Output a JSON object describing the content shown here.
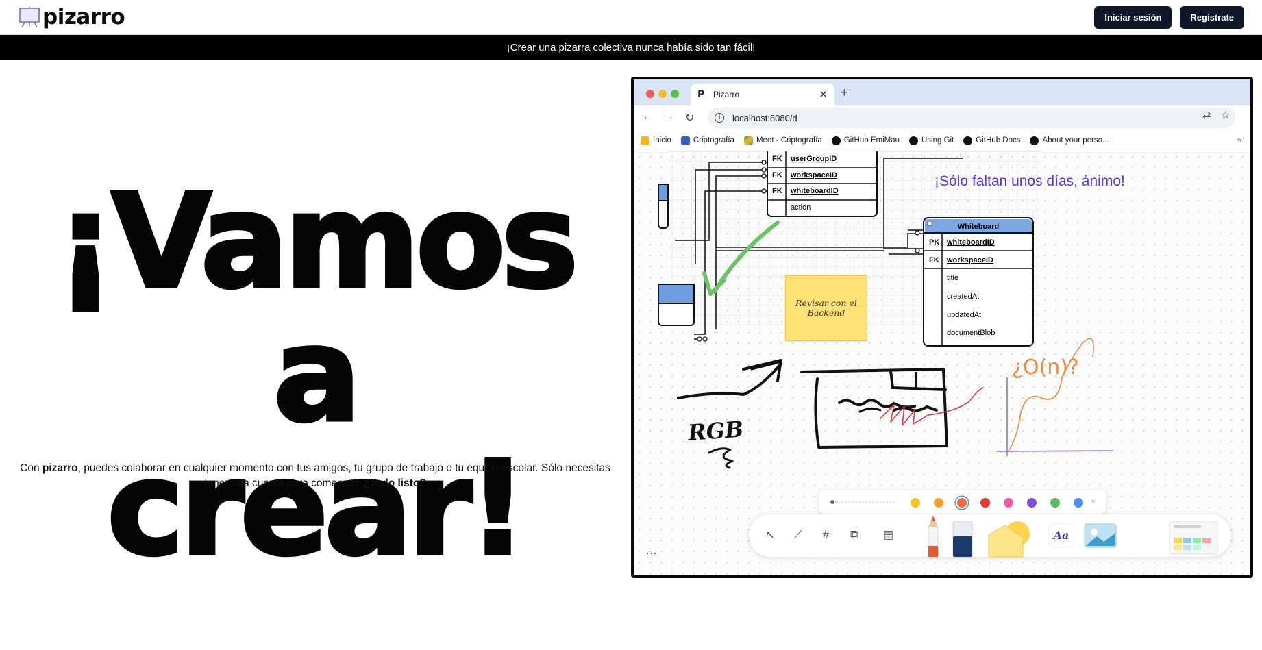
{
  "header": {
    "logo_text": "pizarro",
    "login_label": "Iniciar sesión",
    "register_label": "Regístrate"
  },
  "announcement": "¡Crear una pizarra colectiva nunca había sido tan fácil!",
  "hero": {
    "title_line1": "¡Vamos a",
    "title_line2": "crear!",
    "desc_prefix": "Con ",
    "desc_brand": "pizarro",
    "desc_middle": ", puedes colaborar en cualquier momento con tus amigos, tu grupo de trabajo o tu equipo escolar. Sólo necesitas tener una cuenta para comenzar. ",
    "desc_cta": "¿Todo listo?"
  },
  "browser": {
    "tab_title": "Pizarro",
    "url": "localhost:8080/d",
    "bookmarks": [
      {
        "label": "Inicio",
        "icon": "contacts-icon",
        "color": "#f2b51d"
      },
      {
        "label": "Criptografía",
        "icon": "layout-icon",
        "color": "#3b5cc4"
      },
      {
        "label": "Meet - Criptografía",
        "icon": "meet-icon",
        "color": "#34a853"
      },
      {
        "label": "GitHub EmiMau",
        "icon": "github-icon",
        "color": "#111111"
      },
      {
        "label": "Using Git",
        "icon": "github-icon",
        "color": "#111111"
      },
      {
        "label": "GitHub Docs",
        "icon": "github-icon",
        "color": "#111111"
      },
      {
        "label": "About your perso...",
        "icon": "github-icon",
        "color": "#111111"
      }
    ]
  },
  "whiteboard": {
    "message": "¡Sólo faltan unos días, ánimo!",
    "sticky_note": "Revisar con el Backend",
    "table_top": {
      "rows": [
        {
          "key": "FK",
          "name": "userGroupID"
        },
        {
          "key": "FK",
          "name": "workspaceID"
        },
        {
          "key": "FK",
          "name": "whiteboardID"
        },
        {
          "key": "",
          "name": "action"
        }
      ]
    },
    "table_whiteboard": {
      "title": "Whiteboard",
      "rows": [
        {
          "key": "PK",
          "name": "whiteboardID"
        },
        {
          "key": "FK",
          "name": "workspaceID"
        },
        {
          "key": "",
          "name": "title"
        },
        {
          "key": "",
          "name": "createdAt"
        },
        {
          "key": "",
          "name": "updatedAt"
        },
        {
          "key": "",
          "name": "documentBlob"
        }
      ]
    },
    "handwriting_rgb": "RGB",
    "handwriting_bigo": "¿O(n)?",
    "palette": [
      "#f7c325",
      "#f5a524",
      "#f26b3a",
      "#e53935",
      "#ec5ba7",
      "#7b4fd8",
      "#5cb85c",
      "#4a8ff0"
    ],
    "text_tool_label": "Aa",
    "more_label": "..."
  }
}
